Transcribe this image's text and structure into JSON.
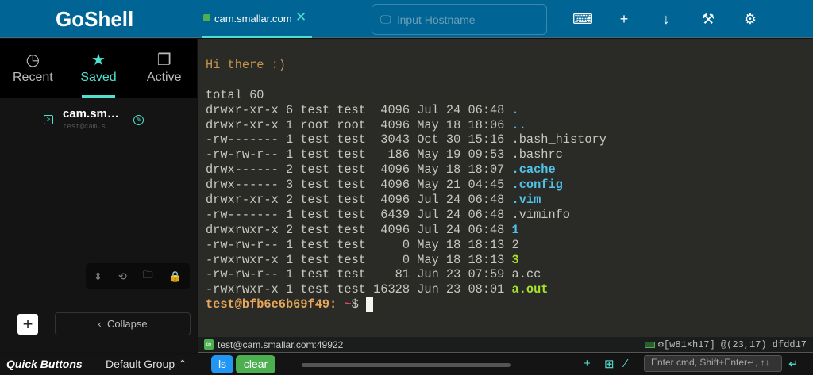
{
  "app": {
    "title": "GoShell"
  },
  "tab": {
    "label": "cam.smallar.com"
  },
  "host": {
    "placeholder": "input Hostname"
  },
  "sidebar": {
    "tabs": [
      {
        "label": "Recent"
      },
      {
        "label": "Saved"
      },
      {
        "label": "Active"
      }
    ],
    "entry": {
      "name": "cam.sm…",
      "sub": "test@cam.s…"
    },
    "collapse_label": "Collapse"
  },
  "terminal": {
    "greeting": "Hi there :)",
    "total": "total 60",
    "rows": [
      {
        "meta": "drwxr-xr-x 6 test test  4096 Jul 24 06:48 ",
        "name": ".",
        "style": "cy"
      },
      {
        "meta": "drwxr-xr-x 1 root root  4096 May 18 18:06 ",
        "name": "..",
        "style": "cy"
      },
      {
        "meta": "-rw------- 1 test test  3043 Oct 30 15:16 ",
        "name": ".bash_history",
        "style": ""
      },
      {
        "meta": "-rw-rw-r-- 1 test test   186 May 19 09:53 ",
        "name": ".bashrc",
        "style": ""
      },
      {
        "meta": "drwx------ 2 test test  4096 May 18 18:07 ",
        "name": ".cache",
        "style": "cyb"
      },
      {
        "meta": "drwx------ 3 test test  4096 May 21 04:45 ",
        "name": ".config",
        "style": "cyb"
      },
      {
        "meta": "drwxr-xr-x 2 test test  4096 Jul 24 06:48 ",
        "name": ".vim",
        "style": "cyb"
      },
      {
        "meta": "-rw------- 1 test test  6439 Jul 24 06:48 ",
        "name": ".viminfo",
        "style": ""
      },
      {
        "meta": "drwxrwxr-x 2 test test  4096 Jul 24 06:48 ",
        "name": "1",
        "style": "cyb"
      },
      {
        "meta": "-rw-rw-r-- 1 test test     0 May 18 18:13 ",
        "name": "2",
        "style": ""
      },
      {
        "meta": "-rwxrwxr-x 1 test test     0 May 18 18:13 ",
        "name": "3",
        "style": "gr"
      },
      {
        "meta": "-rw-rw-r-- 1 test test    81 Jun 23 07:59 ",
        "name": "a.cc",
        "style": ""
      },
      {
        "meta": "-rwxrwxr-x 1 test test 16328 Jun 23 08:01 ",
        "name": "a.out",
        "style": "gr"
      }
    ],
    "prompt_user": "test@bfb6e6b69f49:",
    "prompt_path": " ~",
    "prompt_sym": "$ "
  },
  "status": {
    "address": "test@cam.smallar.com:49922",
    "info": "[w81×h17] @(23,17) dfdd17"
  },
  "bottom": {
    "quick_buttons": "Quick Buttons",
    "group": "Default Group",
    "buttons": [
      "ls",
      "clear"
    ],
    "cmd_placeholder": "Enter cmd, Shift+Enter↵, ↑↓"
  }
}
